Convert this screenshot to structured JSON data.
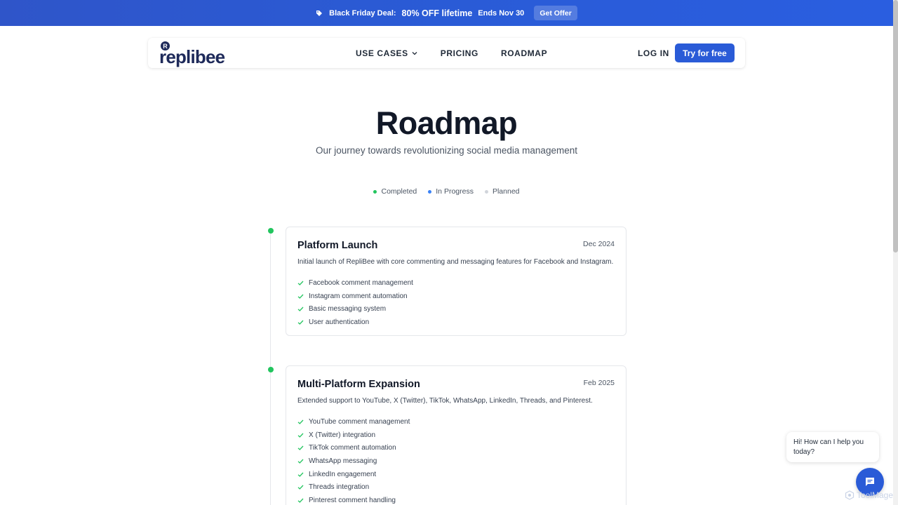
{
  "promo": {
    "label": "Black Friday Deal:",
    "highlight": "80% OFF lifetime",
    "ends": "Ends Nov 30",
    "button": "Get Offer",
    "icon": "tag-icon"
  },
  "nav": {
    "logo_text": "replibee",
    "logo_mark": "R",
    "use_cases": "USE CASES",
    "pricing": "PRICING",
    "roadmap": "ROADMAP",
    "login": "LOG IN",
    "cta": "Try for free"
  },
  "hero": {
    "title": "Roadmap",
    "subtitle": "Our journey towards revolutionizing social media management"
  },
  "legend": [
    {
      "label": "Completed",
      "color": "#22c55e"
    },
    {
      "label": "In Progress",
      "color": "#3b82f6"
    },
    {
      "label": "Planned",
      "color": "#d1d5db"
    }
  ],
  "milestones": [
    {
      "title": "Platform Launch",
      "date": "Dec 2024",
      "status": "Completed",
      "description": "Initial launch of RepliBee with core commenting and messaging features for Facebook and Instagram.",
      "features": [
        "Facebook comment management",
        "Instagram comment automation",
        "Basic messaging system",
        "User authentication"
      ]
    },
    {
      "title": "Multi-Platform Expansion",
      "date": "Feb 2025",
      "status": "Completed",
      "description": "Extended support to YouTube, X (Twitter), TikTok, WhatsApp, LinkedIn, Threads, and Pinterest.",
      "features": [
        "YouTube comment management",
        "X (Twitter) integration",
        "TikTok comment automation",
        "WhatsApp messaging",
        "LinkedIn engagement",
        "Threads integration",
        "Pinterest comment handling"
      ]
    }
  ],
  "chat": {
    "greeting": "Hi! How can I help you today?"
  },
  "watermark": "ToolMage",
  "colors": {
    "brand_blue": "#2a5bd7",
    "completed_green": "#22c55e"
  }
}
